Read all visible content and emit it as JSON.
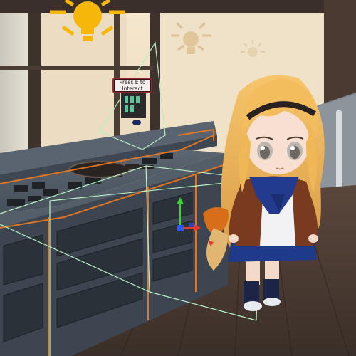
{
  "scene": {
    "interaction_prompt": "Press E to Interact"
  },
  "icons": {
    "primary_light": "light-bulb-gizmo-icon",
    "secondary_lights": [
      "sun-gizmo-icon",
      "sun-gizmo-icon"
    ],
    "transform_gizmo": "move-arrows-gizmo-icon"
  },
  "colors": {
    "selection_outline": "#f07a1e",
    "collider_wireframe": "#b8f0c4",
    "light_bulb": "#f6b70a",
    "gizmo_y_axis": "#39d62c",
    "gizmo_x_axis": "#e23b2e",
    "gizmo_z_axis": "#2f55ff"
  }
}
